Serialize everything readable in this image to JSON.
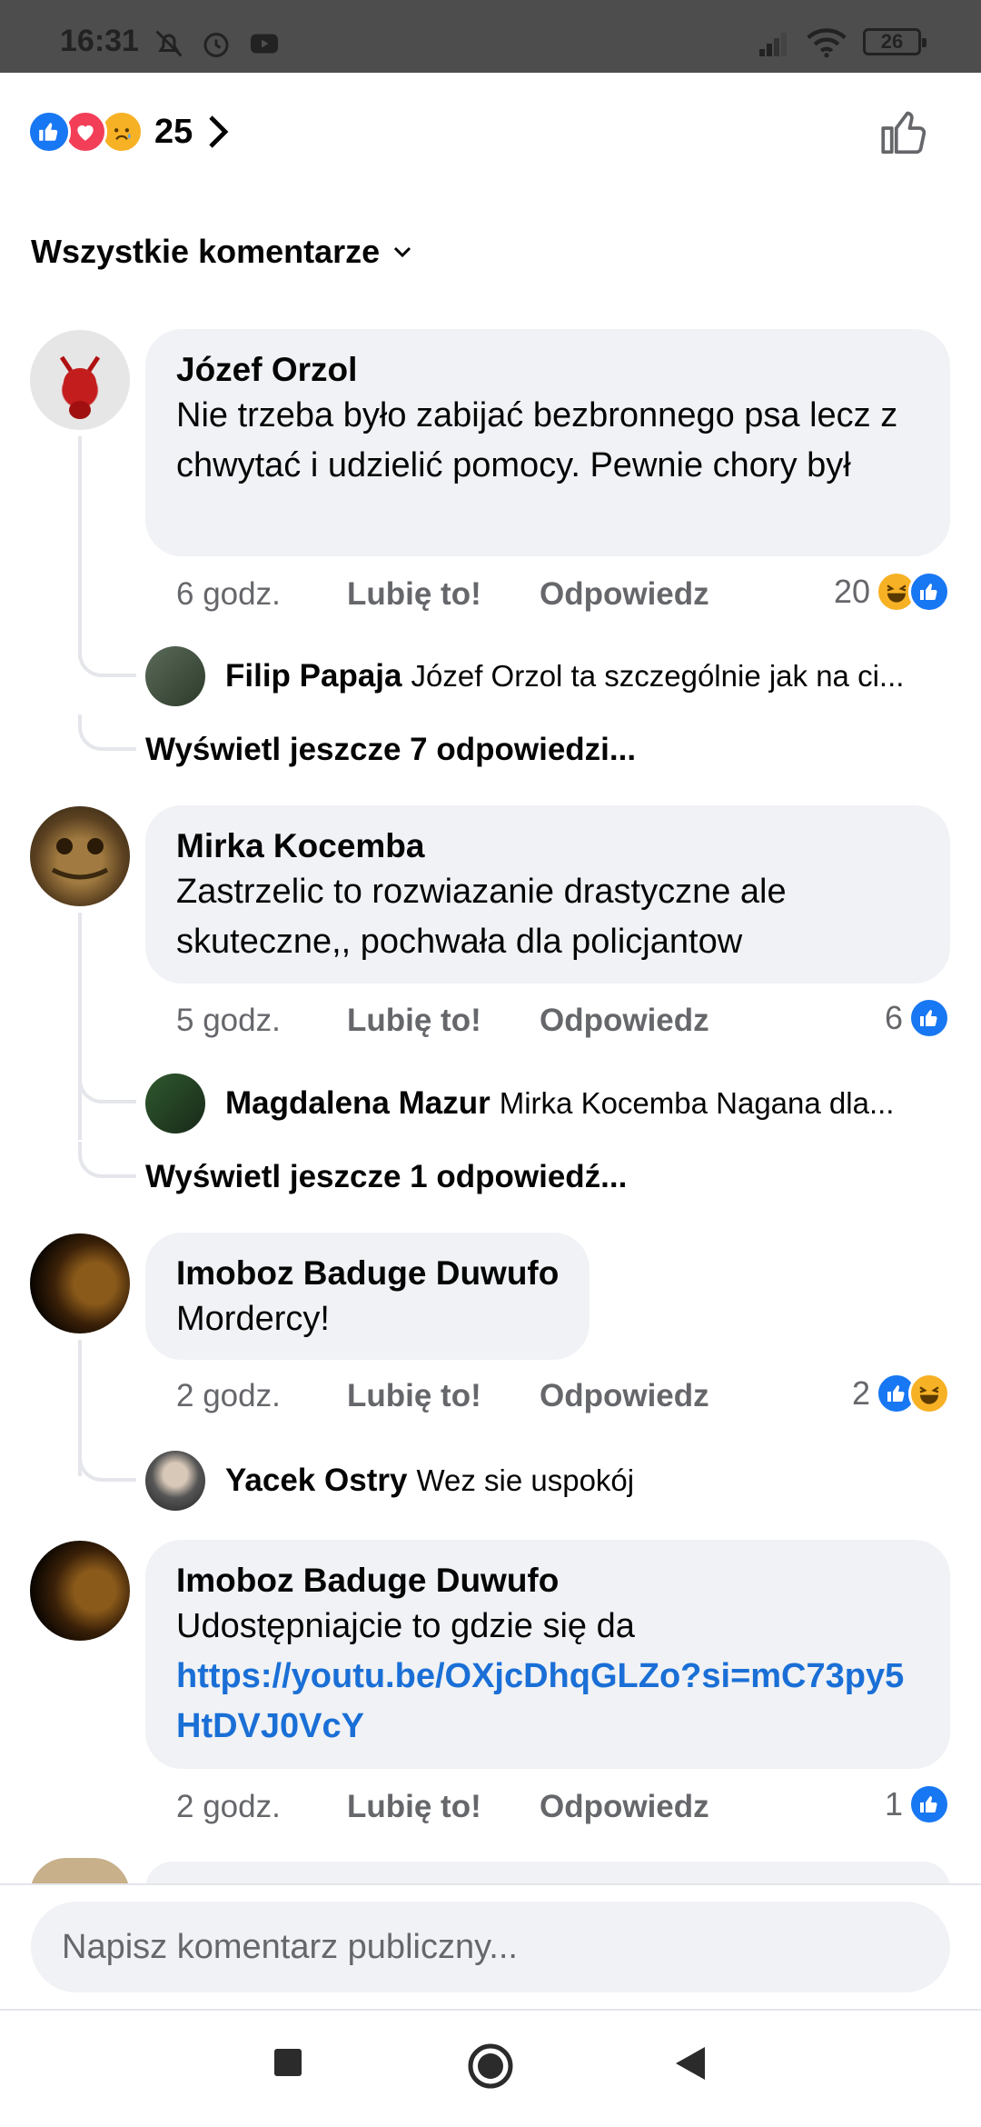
{
  "status_bar": {
    "time": "16:31",
    "battery": "26"
  },
  "reactions": {
    "count": "25",
    "types": [
      "like-icon",
      "love-icon",
      "sad-icon"
    ]
  },
  "filter": {
    "label": "Wszystkie komentarze"
  },
  "comments": [
    {
      "author": "Józef Orzol",
      "text": "Nie trzeba było zabijać bezbronnego psa lecz z chwytać i udzielić pomocy. Pewnie chory był",
      "time": "6 godz.",
      "like_label": "Lubię to!",
      "reply_label": "Odpowiedz",
      "reaction_count": "20",
      "reply": {
        "author": "Filip Papaja",
        "text": "Józef Orzol ta szczególnie jak na ci..."
      },
      "more_replies": "Wyświetl jeszcze 7 odpowiedzi..."
    },
    {
      "author": "Mirka Kocemba",
      "text": "Zastrzelic to rozwiazanie drastyczne ale skuteczne,, pochwała dla policjantow",
      "time": "5 godz.",
      "like_label": "Lubię to!",
      "reply_label": "Odpowiedz",
      "reaction_count": "6",
      "reply": {
        "author": "Magdalena Mazur",
        "text": "Mirka Kocemba Nagana dla..."
      },
      "more_replies": "Wyświetl jeszcze 1 odpowiedź..."
    },
    {
      "author": "Imoboz Baduge Duwufo",
      "text": "Mordercy!",
      "time": "2 godz.",
      "like_label": "Lubię to!",
      "reply_label": "Odpowiedz",
      "reaction_count": "2",
      "reply": {
        "author": "Yacek Ostry",
        "text": "Wez sie uspokój"
      }
    },
    {
      "author": "Imoboz Baduge Duwufo",
      "text": "Udostępniajcie to gdzie się da",
      "link": "https://youtu.be/OXjcDhqGLZo?si=mC73py5HtDVJ0VcY",
      "time": "2 godz.",
      "like_label": "Lubię to!",
      "reply_label": "Odpowiedz",
      "reaction_count": "1"
    }
  ],
  "composer": {
    "placeholder": "Napisz komentarz publiczny..."
  },
  "colors": {
    "accent": "#1877f2",
    "bubble": "#f0f2f5",
    "secondary_text": "#65676b",
    "link": "#1a6fd6"
  }
}
